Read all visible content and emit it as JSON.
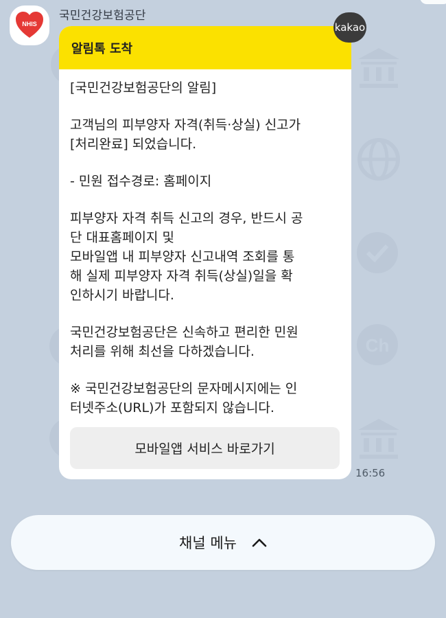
{
  "chat": {
    "sender_name": "국민건강보험공단",
    "avatar_label": "NHIS",
    "badge_label": "kakao",
    "timestamp": "16:56"
  },
  "message": {
    "header": "알림톡 도착",
    "title": "[국민건강보험공단의 알림]",
    "notice_line1": "고객님의 피부양자 자격(취득·상실) 신고가",
    "notice_line2": " [처리완료] 되었습니다.",
    "route": "- 민원 접수경로: 홈페이지",
    "guide_line1": "피부양자 자격 취득 신고의 경우, 반드시 공",
    "guide_line2": "단 대표홈페이지 및",
    "guide_line3": "모바일앱 내 피부양자 신고내역 조회를 통",
    "guide_line4": "해 실제 피부양자 자격 취득(상실)일을 확",
    "guide_line5": "인하시기 바랍니다.",
    "closing_line1": "국민건강보험공단은 신속하고 편리한 민원",
    "closing_line2": "처리를 위해 최선을 다하겠습니다.",
    "warning_line1": "※ 국민건강보험공단의 문자메시지에는 인",
    "warning_line2": "터넷주소(URL)가 포함되지 않습니다.",
    "button_label": "모바일앱 서비스 바로가기"
  },
  "footer": {
    "channel_menu_label": "채널 메뉴"
  },
  "colors": {
    "background": "#c4d0de",
    "header_yellow": "#fbe100",
    "badge": "#3b3b3b",
    "avatar_red": "#e53935"
  },
  "icons": {
    "watermarks": [
      "check-badge-icon",
      "bank-icon",
      "globe-icon",
      "channel-ch-icon",
      "home-icon"
    ],
    "chevron": "chevron-up-icon"
  }
}
